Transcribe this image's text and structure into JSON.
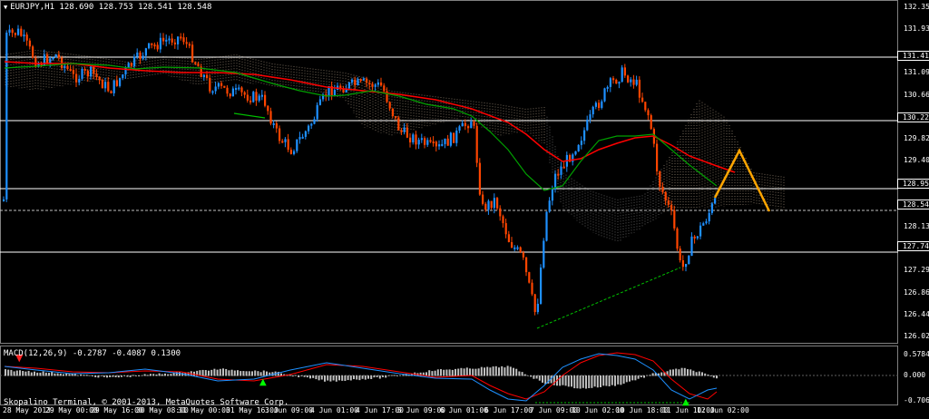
{
  "header": {
    "symbol_info": "EURJPY,H1  128.690 128.753 128.541 128.548"
  },
  "price_scale": {
    "labels": [
      "132.350",
      "131.930",
      "131.415",
      "131.090",
      "130.660",
      "130.228",
      "129.820",
      "129.400",
      "128.952",
      "128.548",
      "128.130",
      "127.745",
      "127.290",
      "126.860",
      "126.440",
      "126.020"
    ],
    "highlighted": [
      "131.415",
      "130.228",
      "128.952",
      "128.548",
      "127.745"
    ]
  },
  "time_axis": {
    "labels": [
      "28 May 2013",
      "29 May 00:00",
      "29 May 16:00",
      "30 May 08:00",
      "31 May 00:00",
      "31 May 16:00",
      "3 Jun 09:00",
      "4 Jun 01:00",
      "4 Jun 17:00",
      "5 Jun 09:00",
      "6 Jun 01:00",
      "6 Jun 17:00",
      "7 Jun 09:00",
      "10 Jun 02:00",
      "10 Jun 18:00",
      "11 Jun 10:00",
      "12 Jun 02:00"
    ]
  },
  "macd": {
    "label": "MACD(12,26,9) -0.2787 -0.4087 0.1300",
    "scale_top": "0.5784",
    "scale_zero": "0.000",
    "scale_bottom": "-0.7067"
  },
  "footer": {
    "copyright": "Skopalino Terminal, © 2001-2013, MetaQuotes Software Corp."
  },
  "colors": {
    "background": "#000000",
    "bull_candle": "#1e90ff",
    "bear_candle": "#ff4500",
    "ma_red": "#ff0000",
    "ma_green": "#00a000",
    "cloud_a": "#ffe4c4",
    "cloud_b": "#c0c0c0",
    "pattern": "#ffa500",
    "macd_hist": "#c0c0c0"
  },
  "icons": [
    "dropdown-triangle-icon",
    "up-arrow-signal-icon",
    "down-arrow-signal-icon"
  ]
}
